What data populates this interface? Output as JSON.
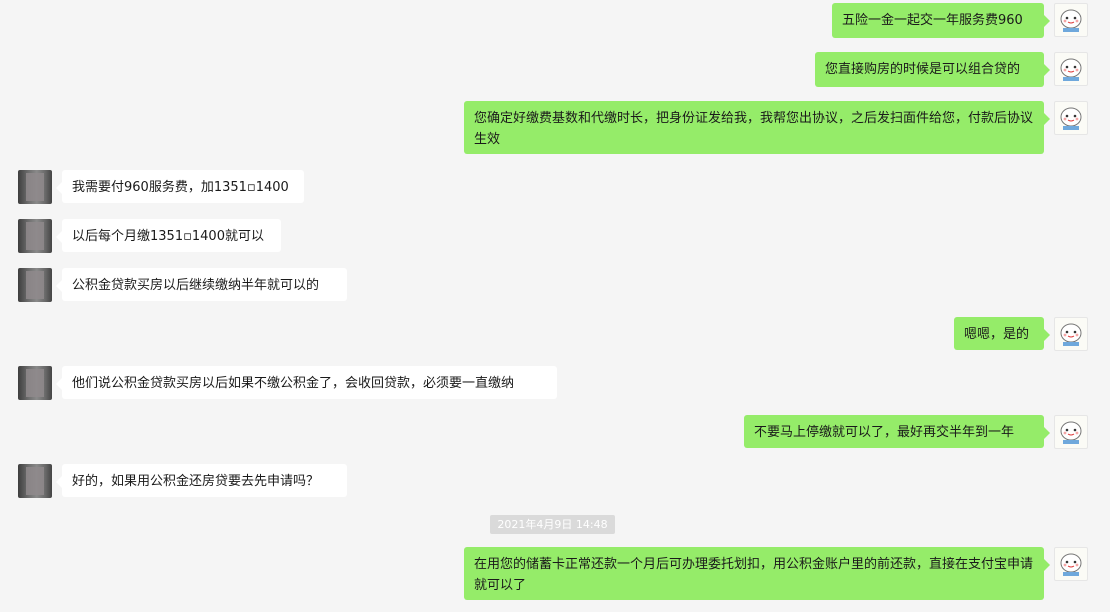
{
  "messages": [
    {
      "side": "out",
      "text": "五险一金一起交一年服务费960"
    },
    {
      "side": "out",
      "text": "您直接购房的时候是可以组合贷的"
    },
    {
      "side": "out",
      "text": "您确定好缴费基数和代缴时长，把身份证发给我，我帮您出协议，之后发扫面件给您，付款后协议生效"
    },
    {
      "side": "in",
      "text": "我需要付960服务费，加1351▫1400"
    },
    {
      "side": "in",
      "text": "以后每个月缴1351▫1400就可以"
    },
    {
      "side": "in",
      "text": "公积金贷款买房以后继续缴纳半年就可以的"
    },
    {
      "side": "out",
      "text": "嗯嗯，是的"
    },
    {
      "side": "in",
      "text": "他们说公积金贷款买房以后如果不缴公积金了，会收回贷款，必须要一直缴纳"
    },
    {
      "side": "out",
      "text": "不要马上停缴就可以了，最好再交半年到一年"
    },
    {
      "side": "in",
      "text": "好的，如果用公积金还房贷要去先申请吗？"
    },
    {
      "side": "out",
      "text": "在用您的储蓄卡正常还款一个月后可办理委托划扣，用公积金账户里的前还款，直接在支付宝申请就可以了"
    }
  ],
  "timestamp": "2021年4月9日 14:48",
  "colors": {
    "background": "#f5f5f5",
    "outgoing_bubble": "#95ec69",
    "incoming_bubble": "#ffffff"
  },
  "icons": {
    "me_avatar": "cartoon-avatar-icon",
    "other_avatar": "blurred-photo-avatar"
  }
}
